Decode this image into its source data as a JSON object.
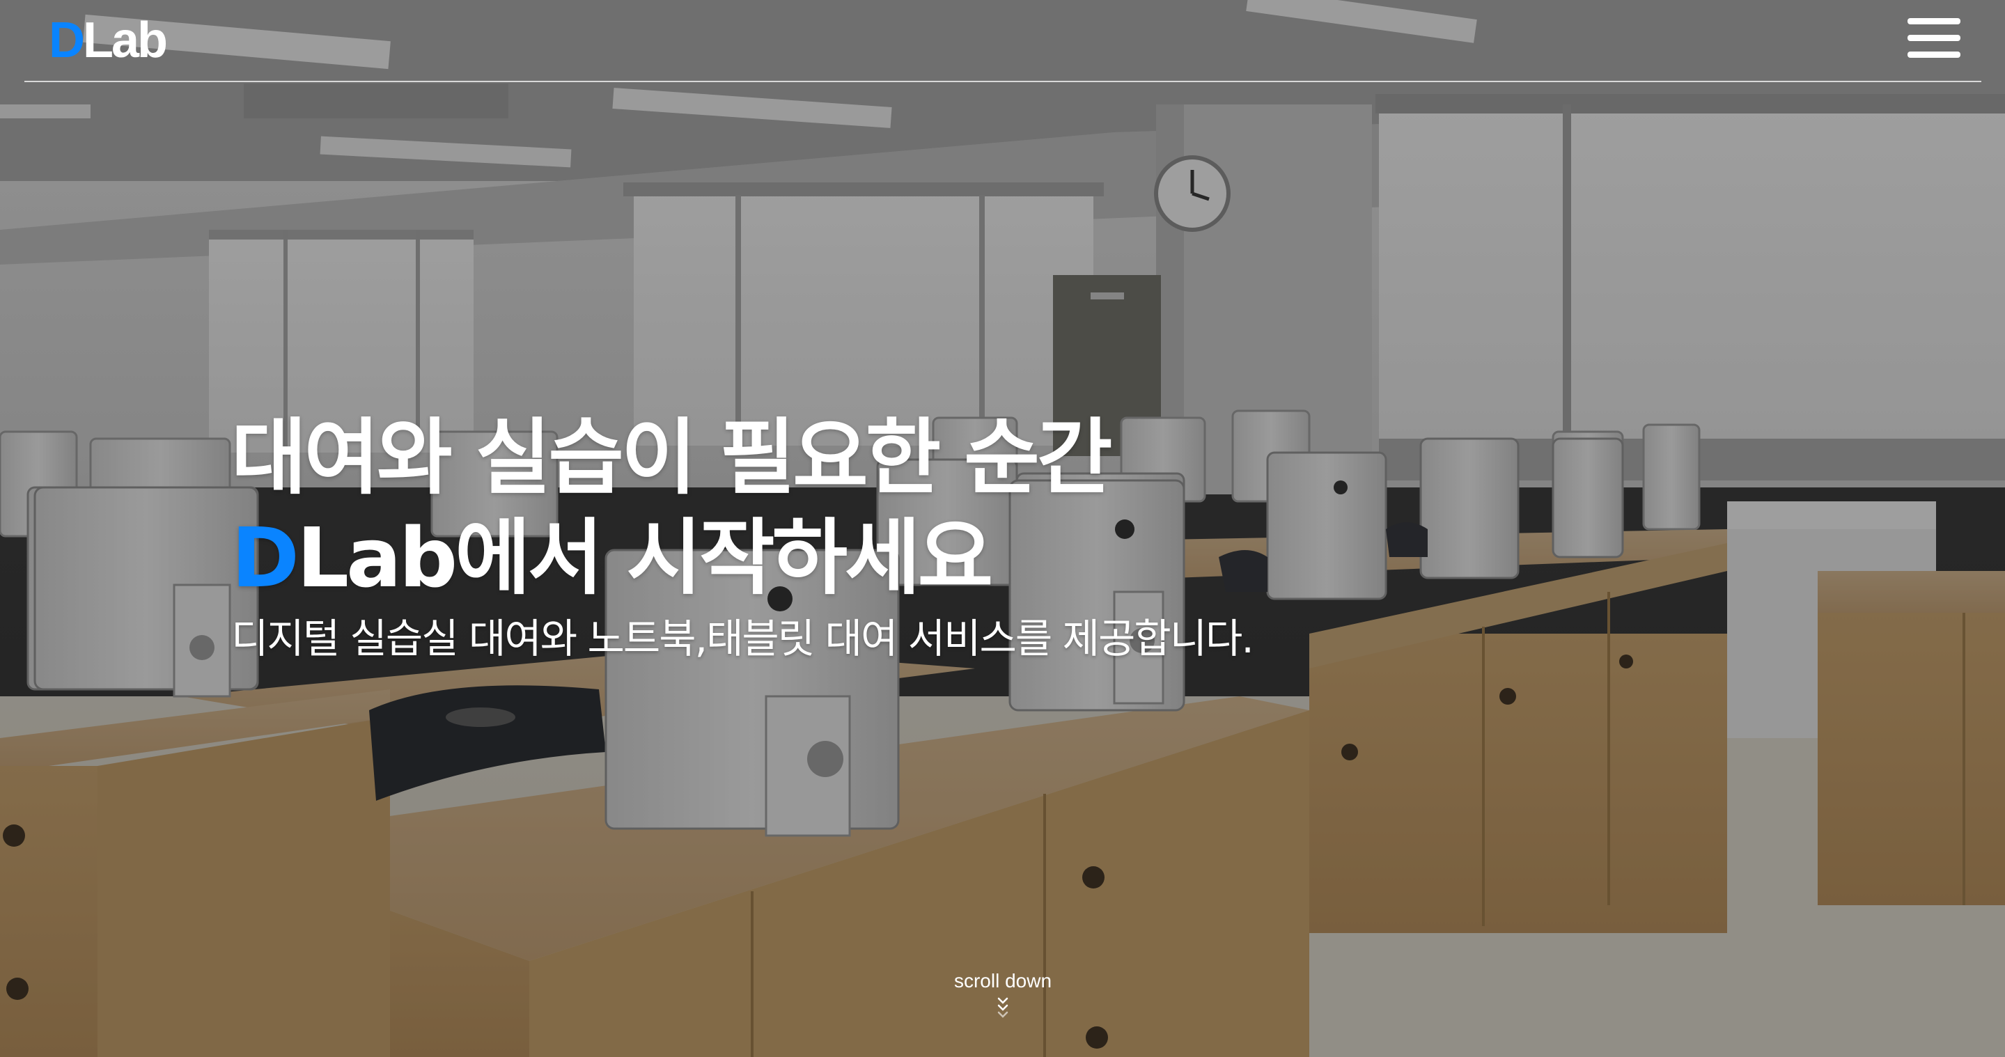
{
  "brand": {
    "logo_accent": "D",
    "logo_rest": "Lab",
    "accent_color": "#0a84ff"
  },
  "header": {
    "menu_icon": "hamburger-menu-icon"
  },
  "hero": {
    "headline_line1": "대여와 실습이 필요한 순간",
    "headline_line2_accent": "D",
    "headline_line2_rest": "Lab에서 시작하세요",
    "subtitle": "디지털 실습실 대여와 노트북,태블릿 대여 서비스를 제공합니다.",
    "scroll_label": "scroll down",
    "scroll_icon": "double-chevron-down-icon"
  }
}
